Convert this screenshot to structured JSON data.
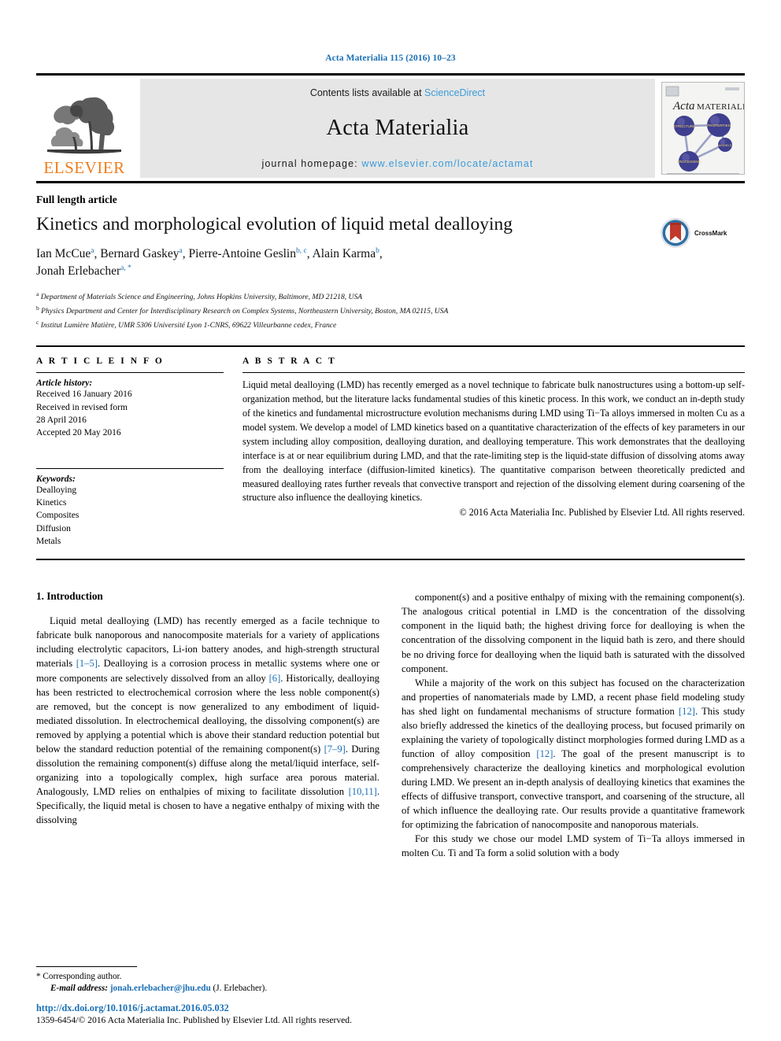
{
  "running_head": "Acta Materialia 115 (2016) 10–23",
  "masthead": {
    "publisher": "ELSEVIER",
    "contents_prefix": "Contents lists available at ",
    "contents_link": "ScienceDirect",
    "journal_name": "Acta Materialia",
    "homepage_prefix": "journal homepage: ",
    "homepage_url": "www.elsevier.com/locate/actamat",
    "cover_title_italic": "Acta",
    "cover_title_rest": "MATERIALIA"
  },
  "article": {
    "type": "Full length article",
    "title": "Kinetics and morphological evolution of liquid metal dealloying",
    "crossmark_label": "CrossMark",
    "authors_line1_parts": [
      {
        "name": "Ian McCue",
        "sup": "a"
      },
      {
        "name": "Bernard Gaskey",
        "sup": "a"
      },
      {
        "name": "Pierre-Antoine Geslin",
        "sup": "b, c"
      },
      {
        "name": "Alain Karma",
        "sup": "b"
      }
    ],
    "authors_line2_parts": [
      {
        "name": "Jonah Erlebacher",
        "sup": "a, *"
      }
    ],
    "affiliations": [
      {
        "mark": "a",
        "text": "Department of Materials Science and Engineering, Johns Hopkins University, Baltimore, MD 21218, USA"
      },
      {
        "mark": "b",
        "text": "Physics Department and Center for Interdisciplinary Research on Complex Systems, Northeastern University, Boston, MA 02115, USA"
      },
      {
        "mark": "c",
        "text": "Institut Lumière Matière, UMR 5306 Université Lyon 1-CNRS, 69622 Villeurbanne cedex, France"
      }
    ]
  },
  "article_info": {
    "heading": "A R T I C L E   I N F O",
    "history_label": "Article history:",
    "history_lines": [
      "Received 16 January 2016",
      "Received in revised form",
      "28 April 2016",
      "Accepted 20 May 2016"
    ],
    "keywords_label": "Keywords:",
    "keywords": [
      "Dealloying",
      "Kinetics",
      "Composites",
      "Diffusion",
      "Metals"
    ]
  },
  "abstract": {
    "heading": "A B S T R A C T",
    "text": "Liquid metal dealloying (LMD) has recently emerged as a novel technique to fabricate bulk nanostructures using a bottom-up self-organization method, but the literature lacks fundamental studies of this kinetic process. In this work, we conduct an in-depth study of the kinetics and fundamental microstructure evolution mechanisms during LMD using Ti−Ta alloys immersed in molten Cu as a model system. We develop a model of LMD kinetics based on a quantitative characterization of the effects of key parameters in our system including alloy composition, dealloying duration, and dealloying temperature. This work demonstrates that the dealloying interface is at or near equilibrium during LMD, and that the rate-limiting step is the liquid-state diffusion of dissolving atoms away from the dealloying interface (diffusion-limited kinetics). The quantitative comparison between theoretically predicted and measured dealloying rates further reveals that convective transport and rejection of the dissolving element during coarsening of the structure also influence the dealloying kinetics.",
    "copyright": "© 2016 Acta Materialia Inc. Published by Elsevier Ltd. All rights reserved."
  },
  "introduction": {
    "heading": "1. Introduction",
    "left_paragraphs": [
      "Liquid metal dealloying (LMD) has recently emerged as a facile technique to fabricate bulk nanoporous and nanocomposite materials for a variety of applications including electrolytic capacitors, Li-ion battery anodes, and high-strength structural materials [1–5]. Dealloying is a corrosion process in metallic systems where one or more components are selectively dissolved from an alloy [6]. Historically, dealloying has been restricted to electrochemical corrosion where the less noble component(s) are removed, but the concept is now generalized to any embodiment of liquid-mediated dissolution. In electrochemical dealloying, the dissolving component(s) are removed by applying a potential which is above their standard reduction potential but below the standard reduction potential of the remaining component(s) [7–9]. During dissolution the remaining component(s) diffuse along the metal/liquid interface, self-organizing into a topologically complex, high surface area porous material. Analogously, LMD relies on enthalpies of mixing to facilitate dissolution [10,11]. Specifically, the liquid metal is chosen to have a negative enthalpy of mixing with the dissolving"
    ],
    "right_paragraphs": [
      "component(s) and a positive enthalpy of mixing with the remaining component(s). The analogous critical potential in LMD is the concentration of the dissolving component in the liquid bath; the highest driving force for dealloying is when the concentration of the dissolving component in the liquid bath is zero, and there should be no driving force for dealloying when the liquid bath is saturated with the dissolved component.",
      "While a majority of the work on this subject has focused on the characterization and properties of nanomaterials made by LMD, a recent phase field modeling study has shed light on fundamental mechanisms of structure formation [12]. This study also briefly addressed the kinetics of the dealloying process, but focused primarily on explaining the variety of topologically distinct morphologies formed during LMD as a function of alloy composition [12]. The goal of the present manuscript is to comprehensively characterize the dealloying kinetics and morphological evolution during LMD. We present an in-depth analysis of dealloying kinetics that examines the effects of diffusive transport, convective transport, and coarsening of the structure, all of which influence the dealloying rate. Our results provide a quantitative framework for optimizing the fabrication of nanocomposite and nanoporous materials.",
      "For this study we chose our model LMD system of Ti−Ta alloys immersed in molten Cu. Ti and Ta form a solid solution with a body"
    ]
  },
  "footnote": {
    "corresponding": "* Corresponding author.",
    "email_label": "E-mail address:",
    "email": "jonah.erlebacher@jhu.edu",
    "email_suffix": "(J. Erlebacher)."
  },
  "footer": {
    "doi": "http://dx.doi.org/10.1016/j.actamat.2016.05.032",
    "issn": "1359-6454/© 2016 Acta Materialia Inc. Published by Elsevier Ltd. All rights reserved."
  },
  "colors": {
    "link_blue": "#1a6fb5",
    "sciencedirect_blue": "#3a9bd9",
    "elsevier_orange": "#ef7d1a",
    "masthead_gray": "#e6e6e6"
  }
}
